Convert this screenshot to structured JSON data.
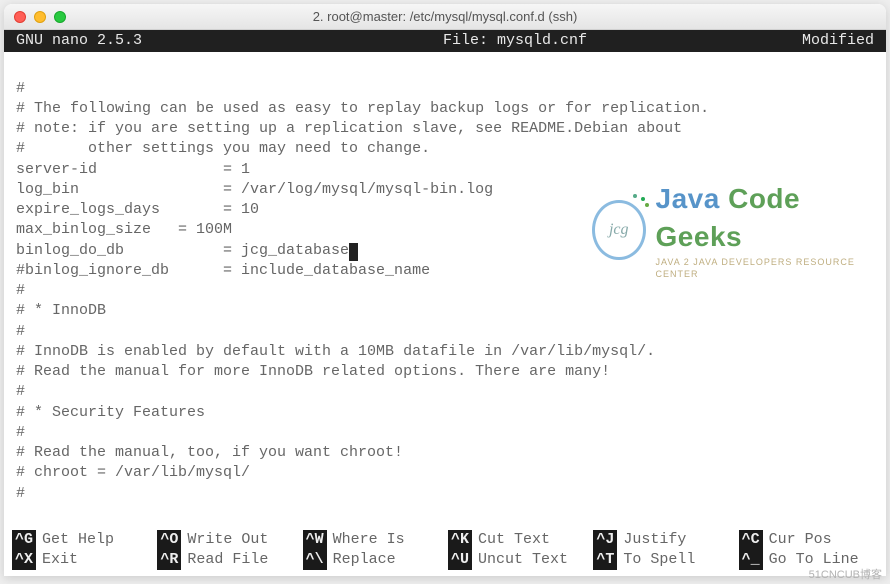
{
  "window": {
    "title": "2. root@master: /etc/mysql/mysql.conf.d (ssh)"
  },
  "nano": {
    "version": "GNU nano 2.5.3",
    "file_label": "File: mysqld.cnf",
    "status": "Modified"
  },
  "lines": {
    "l1": "#",
    "l2": "# The following can be used as easy to replay backup logs or for replication.",
    "l3": "# note: if you are setting up a replication slave, see README.Debian about",
    "l4": "#       other settings you may need to change.",
    "l5": "server-id              = 1",
    "l6": "log_bin                = /var/log/mysql/mysql-bin.log",
    "l7": "expire_logs_days       = 10",
    "l8": "max_binlog_size   = 100M",
    "l9a": "binlog_do_db           = jcg_database",
    "l10": "#binlog_ignore_db      = include_database_name",
    "l11": "#",
    "l12": "# * InnoDB",
    "l13": "#",
    "l14": "# InnoDB is enabled by default with a 10MB datafile in /var/lib/mysql/.",
    "l15": "# Read the manual for more InnoDB related options. There are many!",
    "l16": "#",
    "l17": "# * Security Features",
    "l18": "#",
    "l19": "# Read the manual, too, if you want chroot!",
    "l20": "# chroot = /var/lib/mysql/",
    "l21": "#"
  },
  "shortcuts": {
    "help": {
      "key": "^G",
      "label": "Get Help"
    },
    "exit": {
      "key": "^X",
      "label": "Exit"
    },
    "writeout": {
      "key": "^O",
      "label": "Write Out"
    },
    "readfile": {
      "key": "^R",
      "label": "Read File"
    },
    "whereis": {
      "key": "^W",
      "label": "Where Is"
    },
    "replace": {
      "key": "^\\",
      "label": "Replace"
    },
    "cut": {
      "key": "^K",
      "label": "Cut Text"
    },
    "uncut": {
      "key": "^U",
      "label": "Uncut Text"
    },
    "justify": {
      "key": "^J",
      "label": "Justify"
    },
    "spell": {
      "key": "^T",
      "label": "To Spell"
    },
    "curpos": {
      "key": "^C",
      "label": "Cur Pos"
    },
    "gotoline": {
      "key": "^_",
      "label": "Go To Line"
    }
  },
  "watermark": {
    "badge": "jcg",
    "word1": "Java",
    "word2": "Code",
    "word3": "Geeks",
    "tagline": "Java 2 Java Developers Resource Center"
  },
  "credit": "51CNCUB博客"
}
